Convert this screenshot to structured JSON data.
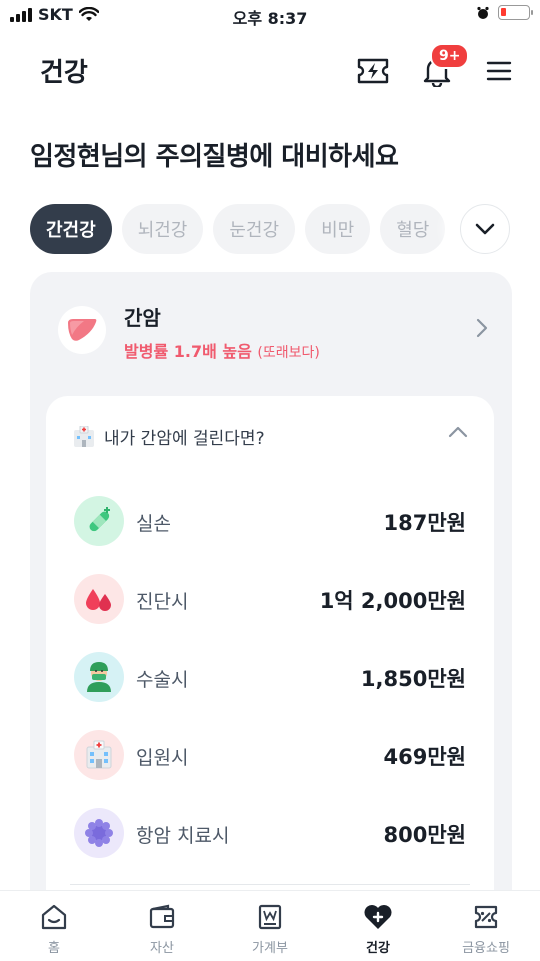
{
  "status": {
    "carrier": "SKT",
    "time": "오후 8:37"
  },
  "header": {
    "title": "건강",
    "notification_count": "9+"
  },
  "headline": "임정현님의 주의질병에 대비하세요",
  "chips": [
    "간건강",
    "뇌건강",
    "눈건강",
    "비만",
    "혈당"
  ],
  "disease": {
    "name": "간암",
    "rate": "발병률 1.7배 높음",
    "rate_note": "(또래보다)"
  },
  "coverage": {
    "question": "내가 간암에 걸린다면?",
    "items": [
      {
        "label": "실손",
        "value": "187만원",
        "icon": "bandage-icon"
      },
      {
        "label": "진단시",
        "value": "1억 2,000만원",
        "icon": "blood-drop-icon"
      },
      {
        "label": "수술시",
        "value": "1,850만원",
        "icon": "surgeon-icon"
      },
      {
        "label": "입원시",
        "value": "469만원",
        "icon": "hospital-icon"
      },
      {
        "label": "항암 치료시",
        "value": "800만원",
        "icon": "virus-icon"
      }
    ]
  },
  "tabs": [
    {
      "label": "홈",
      "icon": "home-icon"
    },
    {
      "label": "자산",
      "icon": "wallet-icon"
    },
    {
      "label": "가계부",
      "icon": "ledger-icon"
    },
    {
      "label": "건강",
      "icon": "heart-plus-icon",
      "active": true
    },
    {
      "label": "금융쇼핑",
      "icon": "coupon-icon"
    }
  ],
  "colors": {
    "accent_red": "#f05a6e",
    "chip_active": "#333d4b",
    "badge": "#f03e3e"
  }
}
